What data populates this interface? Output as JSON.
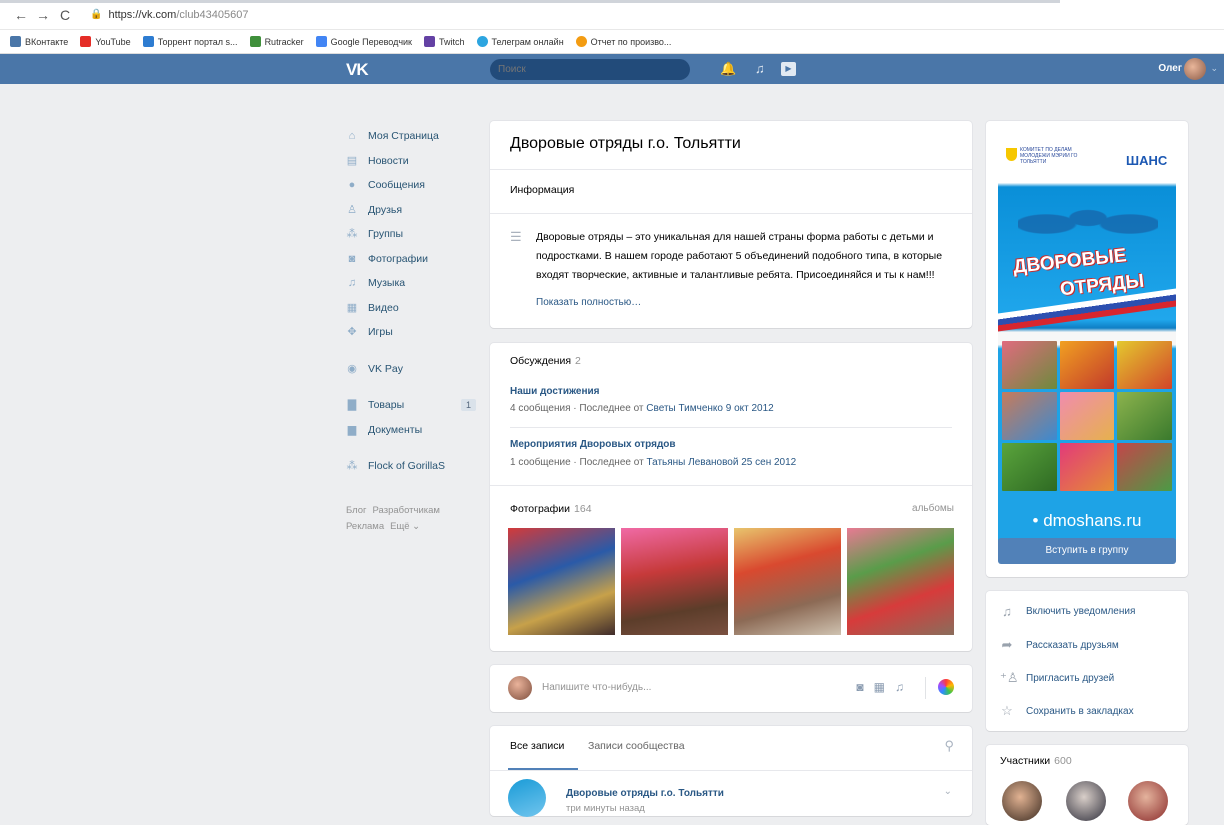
{
  "browser": {
    "url_host": "https://vk.com",
    "url_path": "/club43405607",
    "bookmarks": [
      {
        "label": "ВКонтакте",
        "color": "#4a76a8"
      },
      {
        "label": "YouTube",
        "color": "#e52d27"
      },
      {
        "label": "Торрент портал s...",
        "color": "#2d7cd1"
      },
      {
        "label": "Rutracker",
        "color": "#3f8f3b"
      },
      {
        "label": "Google Переводчик",
        "color": "#4285f4"
      },
      {
        "label": "Twitch",
        "color": "#6441a4"
      },
      {
        "label": "Телеграм онлайн",
        "color": "#2ca5e0"
      },
      {
        "label": "Отчет по произво...",
        "color": "#f39c12"
      }
    ]
  },
  "header": {
    "logo": "VK",
    "search_placeholder": "Поиск",
    "user_name": "Олег"
  },
  "left_menu": {
    "items": [
      {
        "label": "Моя Страница",
        "icon": "home-icon"
      },
      {
        "label": "Новости",
        "icon": "news-icon"
      },
      {
        "label": "Сообщения",
        "icon": "messages-icon"
      },
      {
        "label": "Друзья",
        "icon": "friends-icon"
      },
      {
        "label": "Группы",
        "icon": "groups-icon"
      },
      {
        "label": "Фотографии",
        "icon": "photos-icon"
      },
      {
        "label": "Музыка",
        "icon": "music-icon"
      },
      {
        "label": "Видео",
        "icon": "video-icon"
      },
      {
        "label": "Игры",
        "icon": "games-icon"
      }
    ],
    "vkpay": "VK Pay",
    "goods": "Товары",
    "goods_count": "1",
    "documents": "Документы",
    "flock": "Flock of GorillaS",
    "footer": [
      "Блог",
      "Разработчикам",
      "Реклама",
      "Ещё ⌄"
    ]
  },
  "group": {
    "title": "Дворовые отряды г.о. Тольятти",
    "info_label": "Информация",
    "description": "Дворовые отряды – это уникальная для нашей страны форма работы с детьми и подростками. В нашем городе работают 5 объединений подобного типа, в которые входят творческие, активные и талантливые ребята. Присоединяйся и ты к нам!!!",
    "show_more": "Показать полностью…"
  },
  "discussions": {
    "title": "Обсуждения",
    "count": "2",
    "topics": [
      {
        "name": "Наши достижения",
        "count_text": "4 сообщения",
        "last_prefix": " · Последнее от ",
        "author": "Светы Тимченко",
        "date": " 9 окт 2012"
      },
      {
        "name": "Мероприятия Дворовых отрядов",
        "count_text": "1 сообщение",
        "last_prefix": " · Последнее от ",
        "author": "Татьяны Левановой",
        "date": " 25 сен 2012"
      }
    ]
  },
  "photos": {
    "title": "Фотографии",
    "count": "164",
    "albums": "альбомы"
  },
  "composer": {
    "placeholder": "Напишите что-нибудь..."
  },
  "feed": {
    "tab_all": "Все записи",
    "tab_community": "Записи сообщества",
    "post_author": "Дворовые отряды г.о. Тольятти",
    "post_time": "три минуты назад"
  },
  "cover": {
    "org_text": "КОМИТЕТ ПО ДЕЛАМ МОЛОДЕЖИ МЭРИИ ГО ТОЛЬЯТТИ",
    "shans": "ШАНС",
    "title_line1": "ДВОРОВЫЕ",
    "title_line2": "ОТРЯДЫ",
    "site": "• dmoshans.ru",
    "join_button": "Вступить в группу"
  },
  "actions": [
    {
      "label": "Включить уведомления",
      "icon": "bell-icon"
    },
    {
      "label": "Рассказать друзьям",
      "icon": "share-icon"
    },
    {
      "label": "Пригласить друзей",
      "icon": "invite-icon"
    },
    {
      "label": "Сохранить в закладках",
      "icon": "star-icon"
    }
  ],
  "members": {
    "title": "Участники",
    "count": "600"
  }
}
